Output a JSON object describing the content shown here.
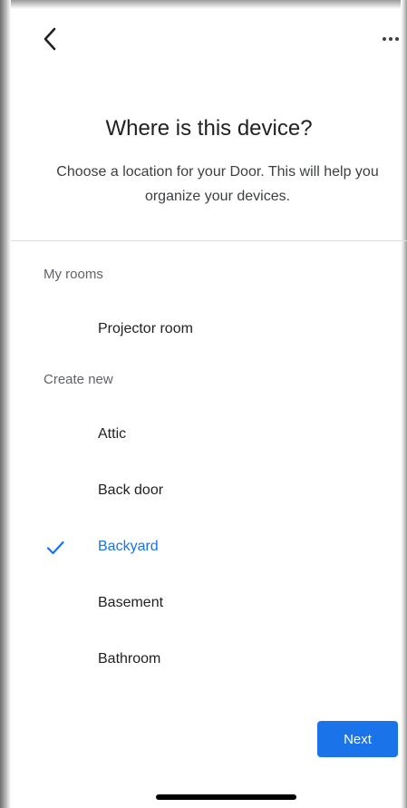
{
  "header": {
    "back_icon": "chevron-left-icon",
    "more_icon": "more-horizontal-icon"
  },
  "title": "Where is this device?",
  "subtitle": "Choose a location for your Door. This will help you organize your devices.",
  "sections": {
    "my_rooms": {
      "label": "My rooms",
      "items": [
        {
          "label": "Projector room",
          "selected": false
        }
      ]
    },
    "create_new": {
      "label": "Create new",
      "items": [
        {
          "label": "Attic",
          "selected": false
        },
        {
          "label": "Back door",
          "selected": false
        },
        {
          "label": "Backyard",
          "selected": true
        },
        {
          "label": "Basement",
          "selected": false
        },
        {
          "label": "Bathroom",
          "selected": false
        }
      ]
    }
  },
  "footer": {
    "next_label": "Next"
  },
  "colors": {
    "accent": "#1a73e8",
    "text_primary": "#202124",
    "text_secondary": "#5f6368",
    "divider": "#dadce0"
  }
}
